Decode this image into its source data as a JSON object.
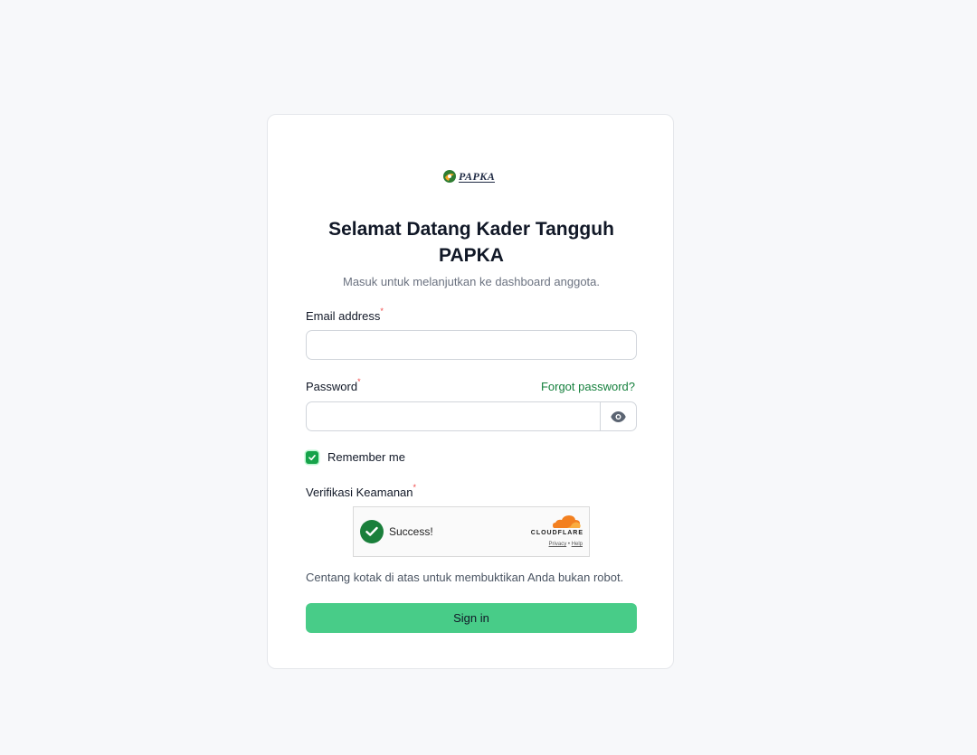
{
  "brand": {
    "logo_text": "PAPKA"
  },
  "header": {
    "title": "Selamat Datang Kader Tangguh PAPKA",
    "subtitle": "Masuk untuk melanjutkan ke dashboard anggota."
  },
  "form": {
    "email": {
      "label": "Email address",
      "required_mark": "*",
      "value": "",
      "placeholder": ""
    },
    "password": {
      "label": "Password",
      "required_mark": "*",
      "value": "",
      "placeholder": "",
      "forgot_link": "Forgot password?",
      "toggle_icon": "eye-icon"
    },
    "remember": {
      "label": "Remember me",
      "checked": true
    },
    "verification": {
      "label": "Verifikasi Keamanan",
      "required_mark": "*",
      "widget": {
        "status_text": "Success!",
        "provider": "CLOUDFLARE",
        "privacy_link": "Privacy",
        "separator": "•",
        "help_link": "Help"
      },
      "hint": "Centang kotak di atas untuk membuktikan Anda bukan robot."
    },
    "submit_label": "Sign in"
  },
  "colors": {
    "page_background": "#f7f8fa",
    "accent_green": "#15803d",
    "button_green": "#48cc88",
    "required_red": "#ef4444",
    "captcha_success": "#1a7f3b",
    "cloudflare_orange": "#f38020"
  }
}
